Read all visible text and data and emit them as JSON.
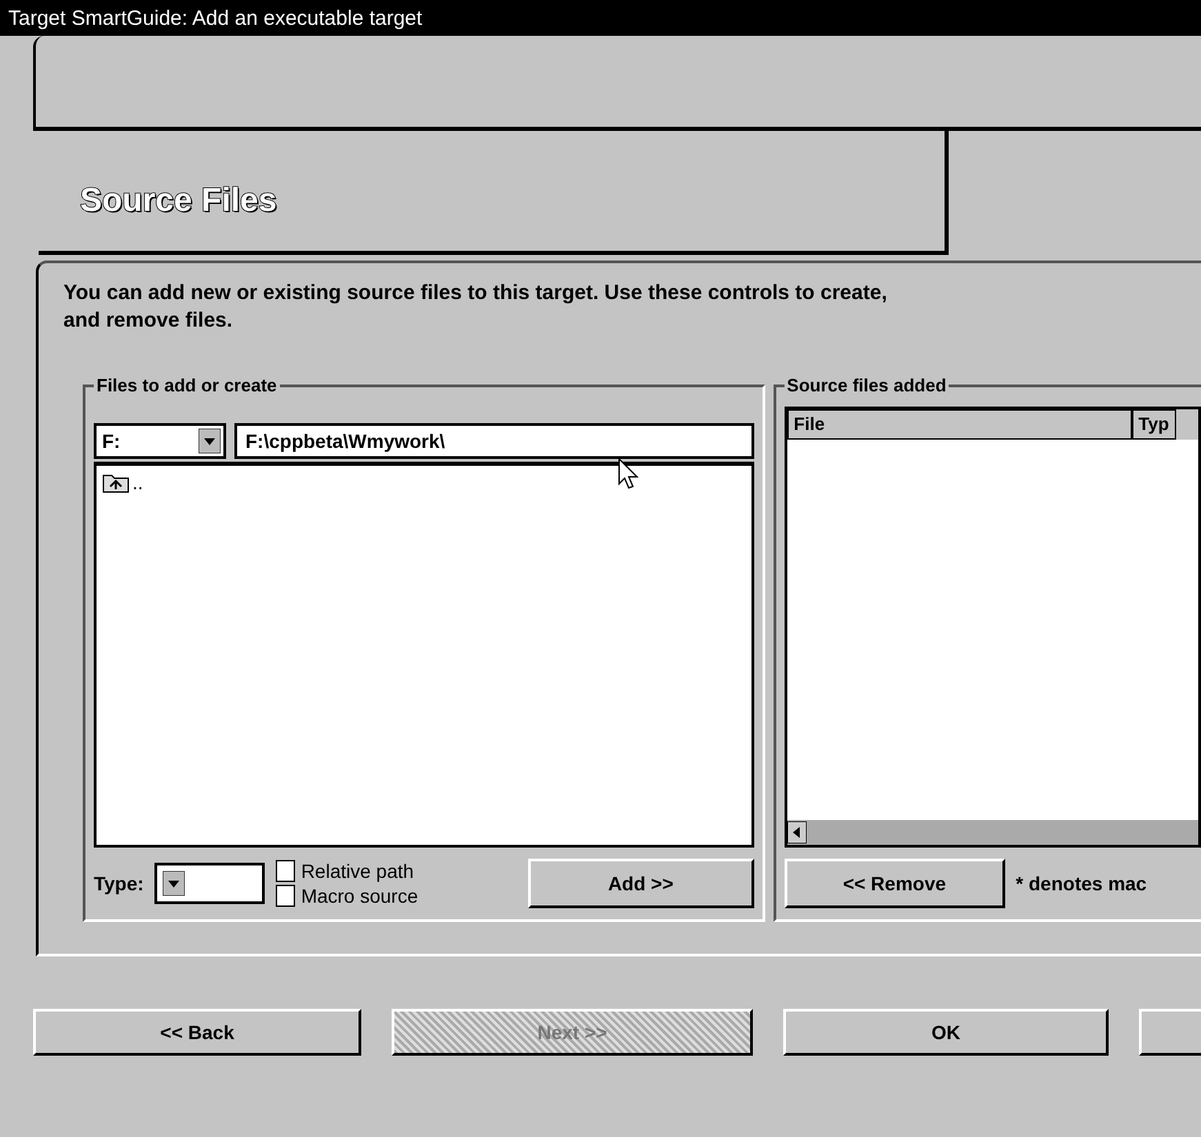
{
  "window": {
    "title": "Target SmartGuide: Add an executable target"
  },
  "page_title": "Source Files",
  "description": "You can add new or existing source files to this target. Use these controls to create,",
  "description_line_2": "and remove files.",
  "files_group": {
    "title": "Files to add or create",
    "drive": "F:",
    "path": "F:\\cppbeta\\Wmywork\\",
    "items": [
      {
        "label": ".."
      }
    ],
    "type_label": "Type:",
    "options": [
      {
        "label": "Relative path",
        "checked": false
      },
      {
        "label": "Macro source",
        "checked": false
      }
    ],
    "add_button": "Add >>"
  },
  "added_group": {
    "title": "Source files added",
    "columns": [
      "File",
      "Typ"
    ],
    "remove_button": "<< Remove",
    "note": "* denotes mac"
  },
  "buttons": [
    {
      "label": "<< Back",
      "disabled": false
    },
    {
      "label": "Next >>",
      "disabled": true
    },
    {
      "label": "OK",
      "disabled": false
    },
    {
      "disabled": false
    }
  ]
}
